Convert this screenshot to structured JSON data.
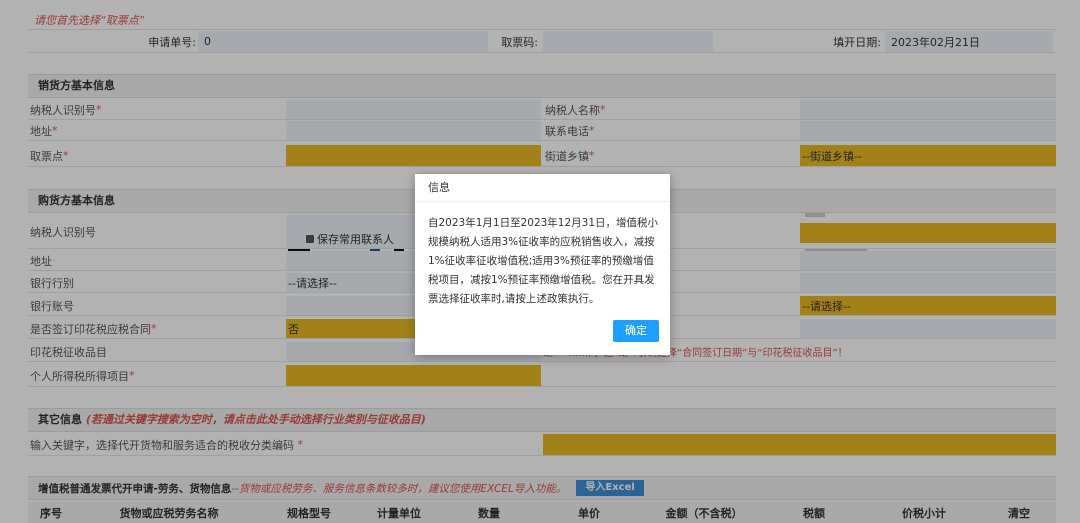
{
  "notice": "请您首先选择“取票点”",
  "apply": {
    "no_label": "申请单号:",
    "no_value": "0",
    "code_label": "取票码:",
    "date_label": "填开日期:",
    "date_value": "2023年02月21日"
  },
  "seller": {
    "title": "销货方基本信息",
    "tax_id_label": "纳税人识别号",
    "name_label": "纳税人名称",
    "address_label": "地址",
    "phone_label": "联系电话",
    "pickup_label": "取票点",
    "street_label": "街道乡镇",
    "street_value": "--街道乡镇--",
    "req": "*"
  },
  "buyer": {
    "title": "购货方基本信息",
    "tax_id_label": "纳税人识别号",
    "save_contact": "保存常用联系人",
    "address_label": "地址",
    "bank_label": "银行行别",
    "bank_value": "--请选择--",
    "account_label": "银行账号",
    "right_select_value": "--请选择--",
    "stamp_contract_label": "是否签订印花税应税合同",
    "stamp_contract_value": "否",
    "stamp_item_label": "印花税征收品目",
    "stamp_hint": "是”一……同”选“是”时,请选择“合同签订日期”与“印花税征收品目”！",
    "income_tax_label": "个人所得税所得项目"
  },
  "other": {
    "title": "其它信息",
    "hint": "(若通过关键字搜索为空时，请点击此处手动选择行业类别与征收品目)",
    "keyword_label": "输入关键字，选择代开货物和服务适合的税收分类编码"
  },
  "goods": {
    "title": "增值税普通发票代开申请-劳务、货物信息",
    "hint": "--货物或应税劳务、服务信息条数较多时，建议您使用EXCEL导入功能。",
    "import_button": "导入Excel",
    "columns": [
      "序号",
      "货物或应税劳务名称",
      "规格型号",
      "计量单位",
      "数量",
      "单价",
      "金额（不含税）",
      "税额",
      "价税小计",
      "清空"
    ]
  },
  "dialog": {
    "title": "信息",
    "message": "自2023年1月1日至2023年12月31日，增值税小规模纳税人适用3%征收率的应税销售收入，减按1%征收率征收增值税;适用3%预征率的预缴增值税项目，减按1%预征率预缴增值税。您在开具发票选择征收率时,请按上述政策执行。",
    "confirm": "确定"
  },
  "colors": {
    "highlight": "#e8b923",
    "field_bg": "#eef3f9",
    "required": "#d9534f",
    "button": "#1e9fff"
  }
}
